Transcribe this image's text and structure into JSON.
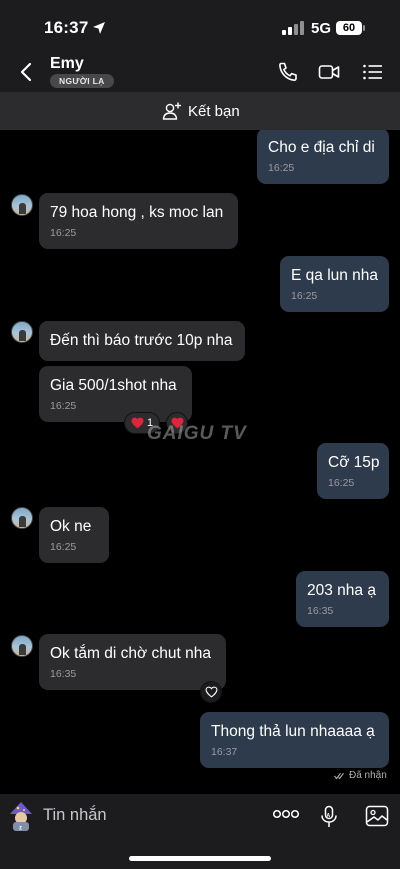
{
  "status_bar": {
    "time": "16:37",
    "network": "5G",
    "battery": "60"
  },
  "header": {
    "contact_name": "Emy",
    "badge": "NGƯỜI LẠ"
  },
  "friend_bar": {
    "label": "Kết bạn"
  },
  "icons": {
    "back": "chevron-left-icon",
    "call": "phone-icon",
    "video": "video-camera-icon",
    "menu": "list-menu-icon",
    "add_friend": "add-person-icon",
    "sticker": "sticker-icon",
    "more": "more-dots-icon",
    "mic": "microphone-icon",
    "gallery": "image-gallery-icon"
  },
  "messages": [
    {
      "side": "out",
      "text": "Cho e địa chỉ di",
      "time": "16:25"
    },
    {
      "side": "in",
      "text": "79 hoa hong , ks moc lan",
      "time": "16:25"
    },
    {
      "side": "out",
      "text": "E qa lun nha",
      "time": "16:25"
    },
    {
      "side": "in",
      "text": "Đến thì báo trước 10p nha",
      "time": ""
    },
    {
      "side": "in",
      "text": "Gia 500/1shot nha",
      "time": "16:25"
    },
    {
      "side": "out",
      "text": "Cỡ 15p",
      "time": "16:25"
    },
    {
      "side": "in",
      "text": "Ok ne",
      "time": "16:25"
    },
    {
      "side": "out",
      "text": "203 nha ạ",
      "time": "16:35"
    },
    {
      "side": "in",
      "text": "Ok tắm di chờ chut nha",
      "time": "16:35"
    },
    {
      "side": "out",
      "text": "Thong thả lun nhaaaa ạ",
      "time": "16:37"
    }
  ],
  "reaction": {
    "count": "1"
  },
  "watermark": "GAIGU TV",
  "seen_label": "Đã nhận",
  "input": {
    "placeholder": "Tin nhắn"
  },
  "colors": {
    "incoming_bubble": "#2c2c2e",
    "outgoing_bubble": "#2e3b4d",
    "reaction_heart": "#e0243b"
  }
}
